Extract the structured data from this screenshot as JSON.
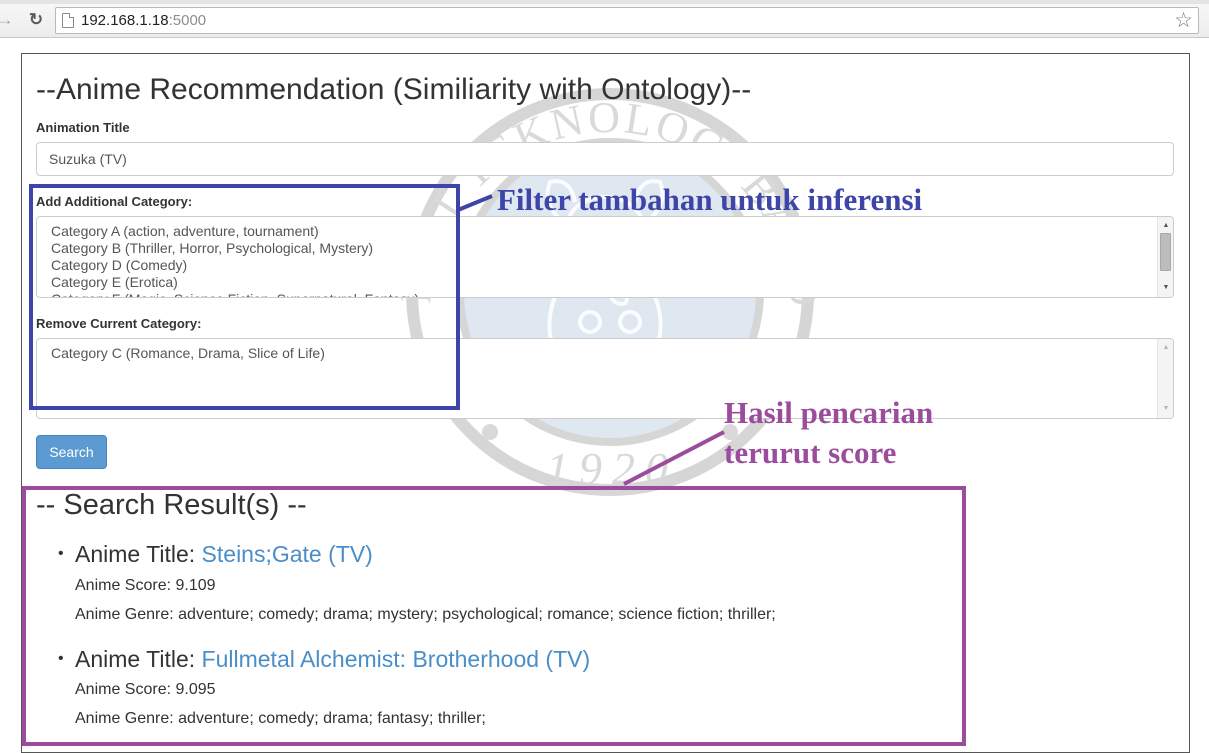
{
  "browser": {
    "url_host": "192.168.1.18",
    "url_port": ":5000"
  },
  "page": {
    "title": "--Anime Recommendation (Similiarity with Ontology)--",
    "animation_title_label": "Animation Title",
    "animation_title_value": "Suzuka (TV)",
    "add_category_label": "Add Additional Category:",
    "add_category_options": [
      "Category A (action, adventure, tournament)",
      "Category B (Thriller, Horror, Psychological, Mystery)",
      "Category D (Comedy)",
      "Category E (Erotica)",
      "Category F (Magic, Science Fiction, Supernatural, Fantasy)"
    ],
    "remove_category_label": "Remove Current Category:",
    "remove_category_options": [
      "Category C (Romance, Drama, Slice of Life)"
    ],
    "search_button": "Search",
    "results_title": "-- Search Result(s) --",
    "results": [
      {
        "title_prefix": "Anime Title: ",
        "title": "Steins;Gate (TV)",
        "score_line": "Anime Score: 9.109",
        "genre_line": "Anime Genre: adventure; comedy; drama; mystery; psychological; romance; science fiction; thriller;"
      },
      {
        "title_prefix": "Anime Title: ",
        "title": "Fullmetal Alchemist: Brotherhood (TV)",
        "score_line": "Anime Score: 9.095",
        "genre_line": "Anime Genre: adventure; comedy; drama; fantasy; thriller;"
      }
    ]
  },
  "watermark": {
    "top_text": "INSTITUT TEKNOLOGI BANDUNG",
    "year": "1920"
  },
  "annotations": {
    "filter_note": "Filter tambahan untuk inferensi",
    "result_note_line1": "Hasil pencarian",
    "result_note_line2": "terurut score",
    "blue_color": "#3d45a9",
    "purple_color": "#9b4c9c"
  },
  "colors": {
    "link": "#4a8ec8",
    "button": "#5b9bd1"
  }
}
